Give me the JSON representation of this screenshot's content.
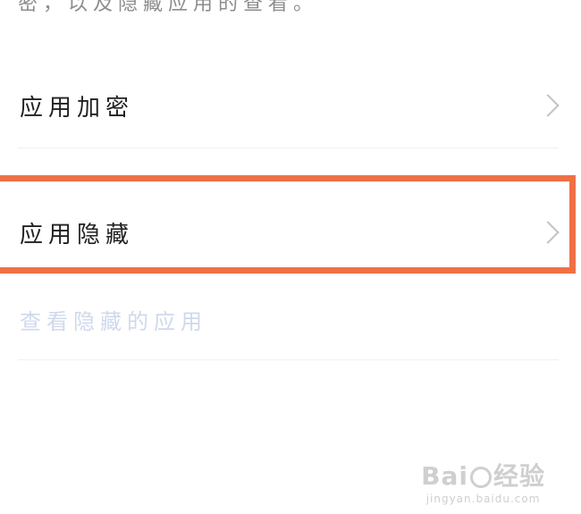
{
  "description": "密，以及隐藏应用的查看。",
  "menu": {
    "items": [
      {
        "label": "应用加密"
      },
      {
        "label": "应用隐藏"
      }
    ],
    "view_hidden_label": "查看隐藏的应用"
  },
  "highlight": {
    "color": "#f07045"
  },
  "watermark": {
    "brand_left": "Bai",
    "brand_right": "经验",
    "url": "jingyan.baidu.com"
  }
}
